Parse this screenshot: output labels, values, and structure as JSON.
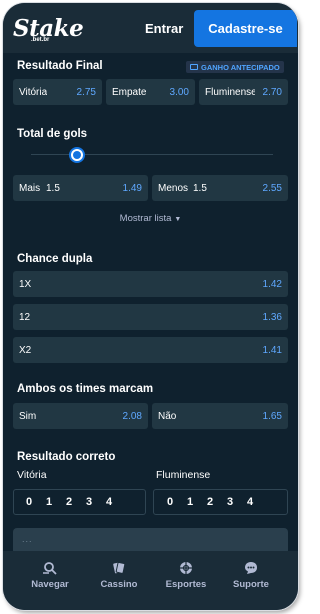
{
  "header": {
    "logo": "Stake",
    "logo_sub": ".bet.br",
    "login_label": "Entrar",
    "signup_label": "Cadastre-se"
  },
  "resultado_final": {
    "title": "Resultado Final",
    "badge": "GANHO ANTECIPADO",
    "options": [
      {
        "label": "Vitória",
        "odd": "2.75"
      },
      {
        "label": "Empate",
        "odd": "3.00"
      },
      {
        "label": "Fluminense",
        "odd": "2.70"
      }
    ]
  },
  "total_gols": {
    "title": "Total de gols",
    "slider_fraction": 0.16,
    "options": [
      {
        "label": "Mais",
        "line": "1.5",
        "odd": "1.49"
      },
      {
        "label": "Menos",
        "line": "1.5",
        "odd": "2.55"
      }
    ],
    "show_list_label": "Mostrar lista"
  },
  "chance_dupla": {
    "title": "Chance dupla",
    "options": [
      {
        "label": "1X",
        "odd": "1.42"
      },
      {
        "label": "12",
        "odd": "1.36"
      },
      {
        "label": "X2",
        "odd": "1.41"
      }
    ]
  },
  "ambos_marcam": {
    "title": "Ambos os times marcam",
    "options": [
      {
        "label": "Sim",
        "odd": "2.08"
      },
      {
        "label": "Não",
        "odd": "1.65"
      }
    ]
  },
  "resultado_correto": {
    "title": "Resultado correto",
    "home_label": "Vitória",
    "away_label": "Fluminense",
    "home_scores": [
      "0",
      "1",
      "2",
      "3",
      "4"
    ],
    "away_scores": [
      "0",
      "1",
      "2",
      "3",
      "4"
    ],
    "more_placeholder": "..."
  },
  "bottom_nav": {
    "items": [
      {
        "label": "Navegar",
        "icon": "browse-icon"
      },
      {
        "label": "Cassino",
        "icon": "cards-icon"
      },
      {
        "label": "Esportes",
        "icon": "ball-icon"
      },
      {
        "label": "Suporte",
        "icon": "chat-icon"
      }
    ]
  },
  "colors": {
    "background": "#0f212e",
    "panel": "#213743",
    "accent": "#1475e1",
    "odd_text": "#5fa8ff"
  }
}
